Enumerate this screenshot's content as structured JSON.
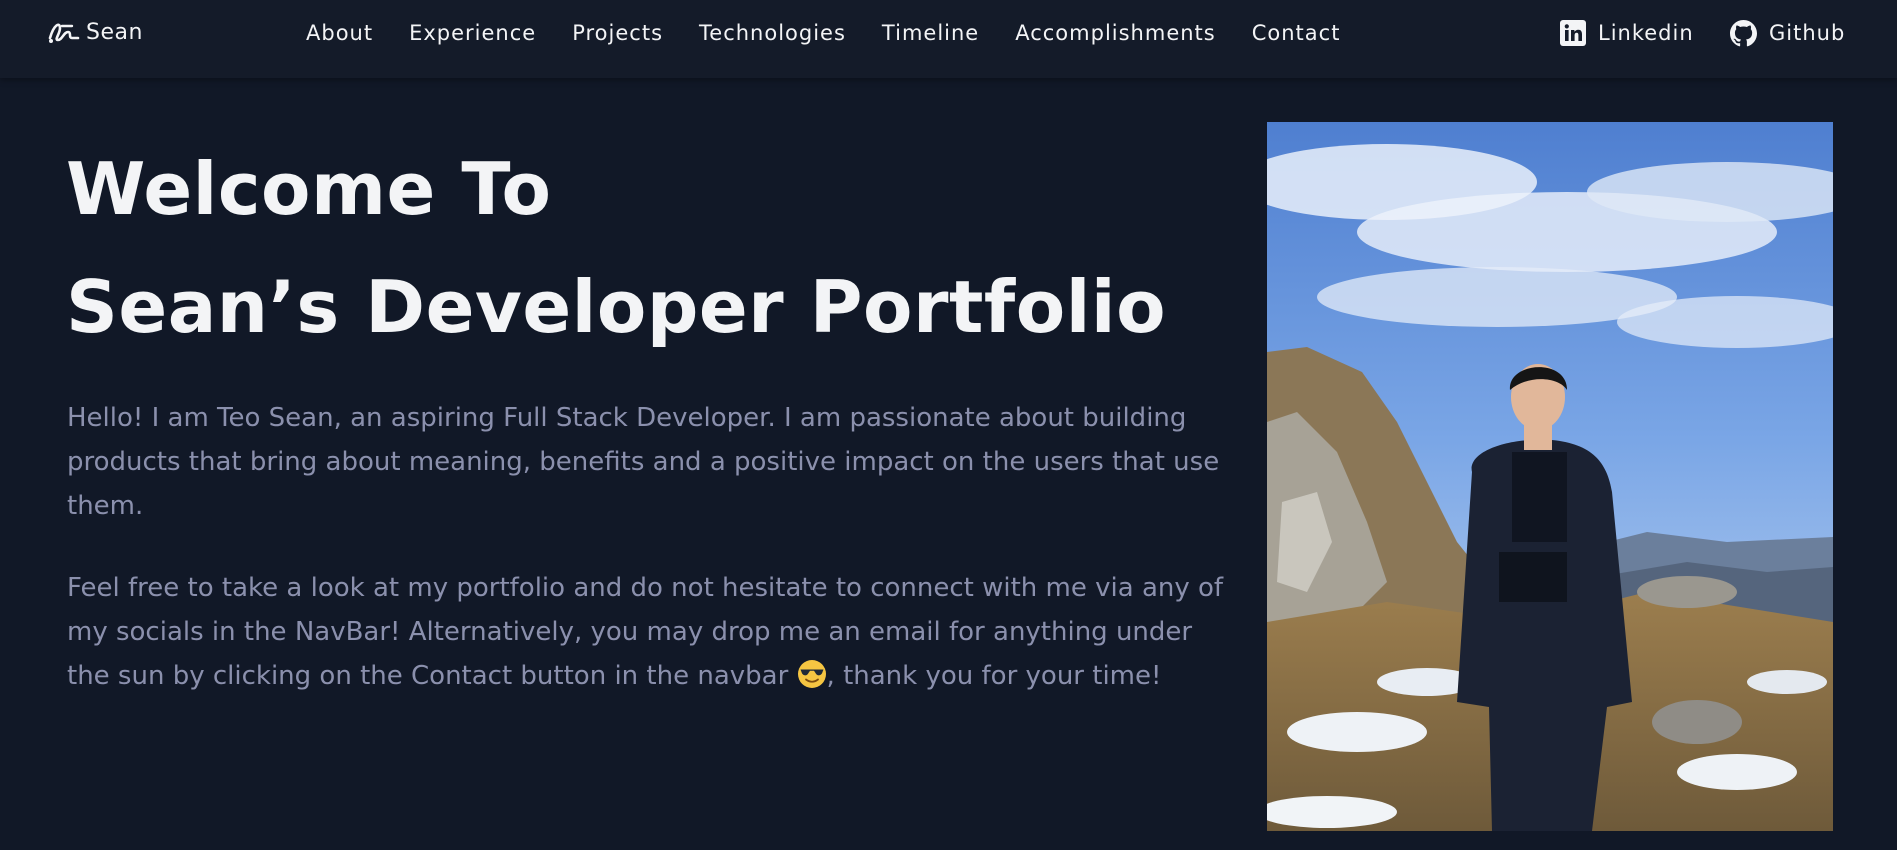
{
  "brand": {
    "name": "Sean"
  },
  "nav": {
    "items": [
      {
        "label": "About"
      },
      {
        "label": "Experience"
      },
      {
        "label": "Projects"
      },
      {
        "label": "Technologies"
      },
      {
        "label": "Timeline"
      },
      {
        "label": "Accomplishments"
      },
      {
        "label": "Contact"
      }
    ]
  },
  "socials": {
    "linkedin": {
      "label": "Linkedin",
      "icon": "linkedin-icon"
    },
    "github": {
      "label": "Github",
      "icon": "github-icon"
    }
  },
  "hero": {
    "title_line1": "Welcome To",
    "title_line2": "Sean’s Developer Portfolio",
    "paragraph1": "Hello! I am Teo Sean, an aspiring Full Stack Developer. I am passionate about building products that bring about meaning, benefits and a positive impact on the users that use them.",
    "paragraph2_before": "Feel free to take a look at my portfolio and do not hesitate to connect with me via any of my socials in the NavBar! Alternatively, you may drop me an email for anything under the sun by clicking on the Contact button in the navbar ",
    "paragraph2_after": ", thank you for your time!",
    "emoji_icon": "smiling-face-with-sunglasses-icon",
    "photo_icon": "profile-photo"
  },
  "colors": {
    "background": "#111827",
    "navbar": "#141b29",
    "heading": "#f3f4f6",
    "body_text": "#8b90ad"
  }
}
